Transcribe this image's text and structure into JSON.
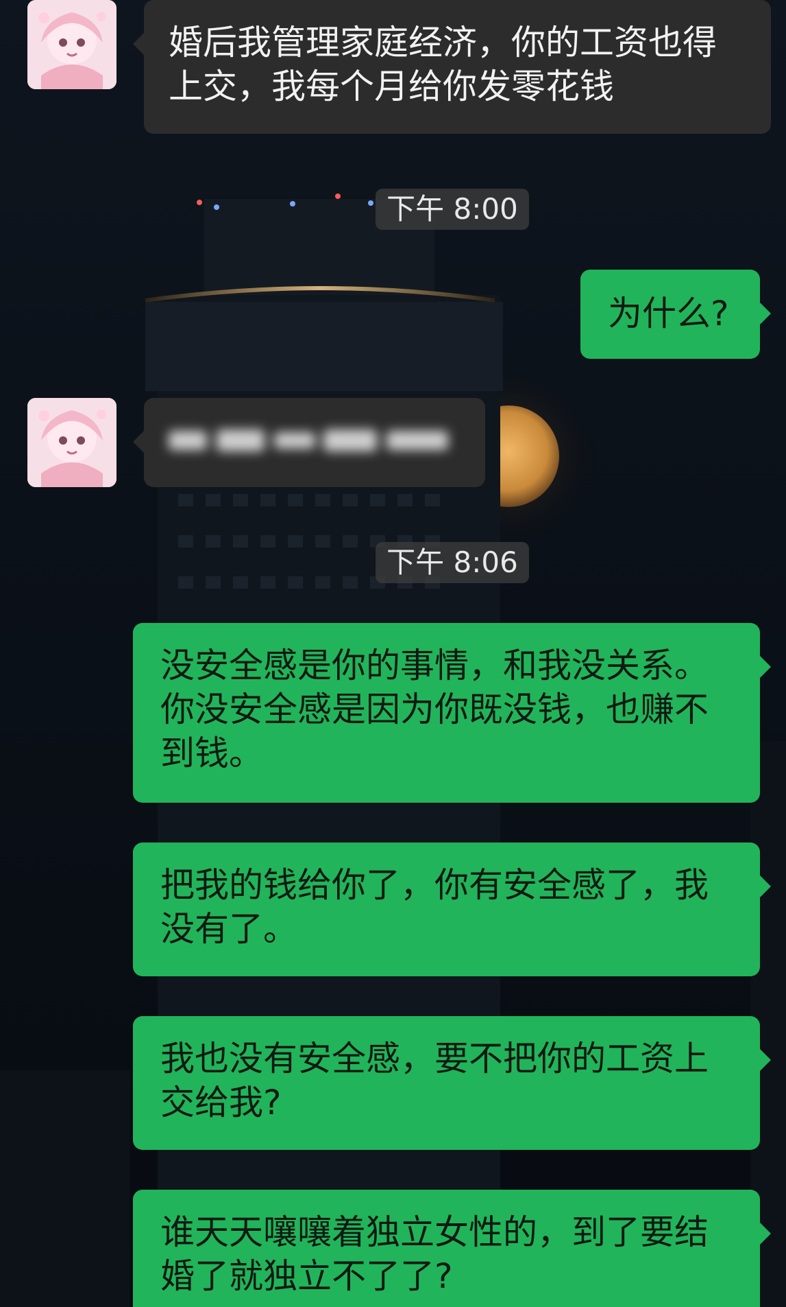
{
  "conversation": {
    "timestamps": [
      "下午 8:00",
      "下午 8:06"
    ],
    "messages": [
      {
        "from": "other",
        "text": "婚后我管理家庭经济，你的工资也得上交，我每个月给你发零花钱"
      },
      {
        "from": "me",
        "text": "为什么?"
      },
      {
        "from": "other",
        "text": "",
        "state": "blurred"
      },
      {
        "from": "me",
        "text": "没安全感是你的事情，和我没关系。你没安全感是因为你既没钱，也赚不到钱。"
      },
      {
        "from": "me",
        "text": "把我的钱给你了，你有安全感了，我没有了。"
      },
      {
        "from": "me",
        "text": "我也没有安全感，要不把你的工资上交给我?"
      },
      {
        "from": "me",
        "text": "谁天天嚷嚷着独立女性的，到了要结婚了就独立不了了?"
      }
    ]
  },
  "colors": {
    "outgoing_bubble": "#22b45a",
    "incoming_bubble": "#2c2c2c",
    "timestamp_bg": "#3c3c3c",
    "background": "#0b1119"
  },
  "icons": {
    "avatar": "anime-girl-avatar"
  }
}
